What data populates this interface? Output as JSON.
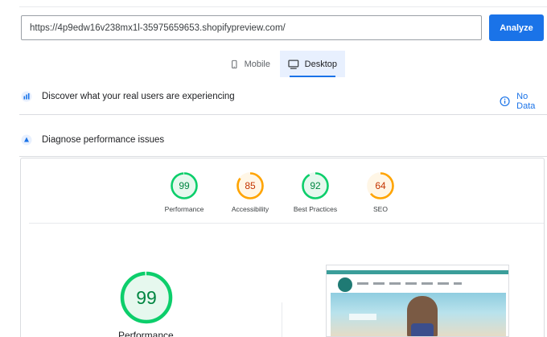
{
  "url_input": {
    "value": "https://4p9edw16v238mx1l-35975659653.shopifypreview.com/"
  },
  "analyze_label": "Analyze",
  "device_tabs": {
    "mobile": "Mobile",
    "desktop": "Desktop",
    "selected": "desktop"
  },
  "discover": {
    "title": "Discover what your real users are experiencing",
    "status": "No Data"
  },
  "diagnose": {
    "title": "Diagnose performance issues"
  },
  "scores": [
    {
      "label": "Performance",
      "value": "99",
      "score": 0.99,
      "color": "#0cce6b",
      "text_color": "#018642",
      "fill": "#e6f8ee"
    },
    {
      "label": "Accessibility",
      "value": "85",
      "score": 0.85,
      "color": "#ffa400",
      "text_color": "#c33300",
      "fill": "#fff6e6"
    },
    {
      "label": "Best Practices",
      "value": "92",
      "score": 0.92,
      "color": "#0cce6b",
      "text_color": "#018642",
      "fill": "#e6f8ee"
    },
    {
      "label": "SEO",
      "value": "64",
      "score": 0.64,
      "color": "#ffa400",
      "text_color": "#c33300",
      "fill": "#fff6e6"
    }
  ],
  "main_score": {
    "label": "Performance",
    "value": "99",
    "score": 0.99,
    "color": "#0cce6b",
    "text_color": "#018642",
    "fill": "#e6f8ee"
  },
  "colors": {
    "accent": "#1a73e8"
  }
}
